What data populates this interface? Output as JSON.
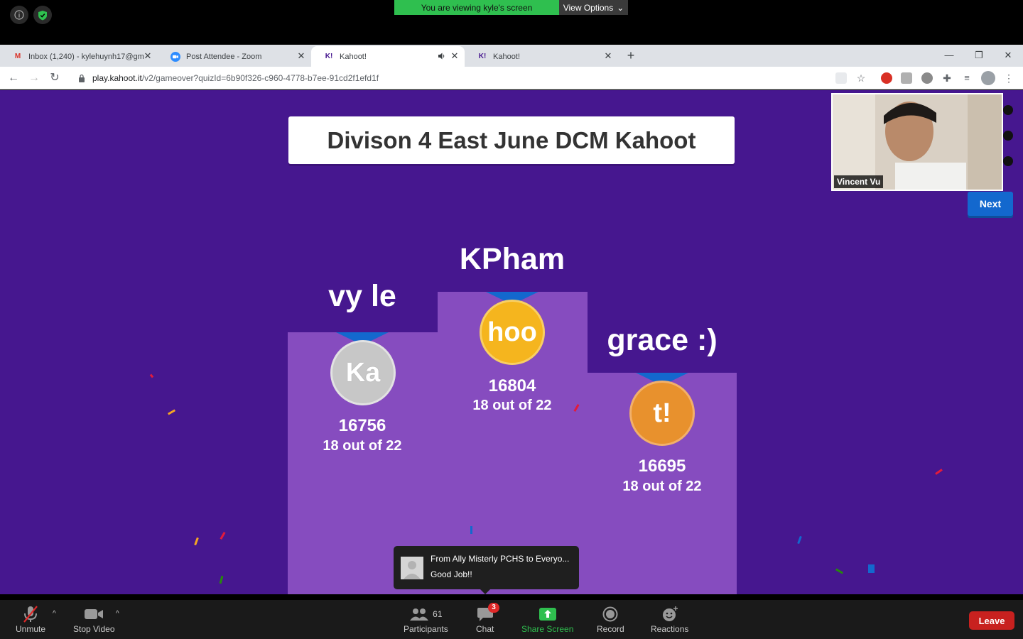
{
  "zoom_top": {
    "banner_text": "You are viewing kyle's screen",
    "view_options_label": "View Options"
  },
  "browser": {
    "tabs": [
      {
        "title": "Inbox (1,240) - kylehuynh17@gm",
        "favicon": "gmail-icon"
      },
      {
        "title": "Post Attendee - Zoom",
        "favicon": "zoom-icon"
      },
      {
        "title": "Kahoot!",
        "favicon": "kahoot-icon",
        "active": true,
        "audio": true
      },
      {
        "title": "Kahoot!",
        "favicon": "kahoot-icon"
      }
    ],
    "url_host": "play.kahoot.it",
    "url_path": "/v2/gameover?quizId=6b90f326-c960-4778-b7ee-91cd2f1efd1f"
  },
  "kahoot": {
    "quiz_title": "Divison 4 East June DCM Kahoot",
    "next_label": "Next",
    "podium": [
      {
        "place": 1,
        "name": "KPham",
        "score": "16804",
        "correct": "18 out of 22",
        "medal_text": "hoo",
        "medal_color": "#f5a623"
      },
      {
        "place": 2,
        "name": "vy le",
        "score": "16756",
        "correct": "18 out of 22",
        "medal_text": "Ka",
        "medal_color": "#c7c7c7"
      },
      {
        "place": 3,
        "name": "grace :)",
        "score": "16695",
        "correct": "18 out of 22",
        "medal_text": "t!",
        "medal_color": "#e8912d"
      }
    ]
  },
  "video": {
    "participant_name": "Vincent Vu"
  },
  "chat_popup": {
    "from": "From Ally Misterly PCHS to Everyo...",
    "message": "Good Job!!"
  },
  "toolbar": {
    "unmute": "Unmute",
    "stop_video": "Stop Video",
    "participants": "Participants",
    "participants_count": "61",
    "chat": "Chat",
    "chat_badge": "3",
    "share_screen": "Share Screen",
    "record": "Record",
    "reactions": "Reactions",
    "leave": "Leave"
  },
  "colors": {
    "kahoot_bg": "#46178f",
    "podium": "#864cbf",
    "share_green": "#2fbf4f",
    "leave_red": "#c8211f",
    "next_blue": "#1368ce"
  }
}
